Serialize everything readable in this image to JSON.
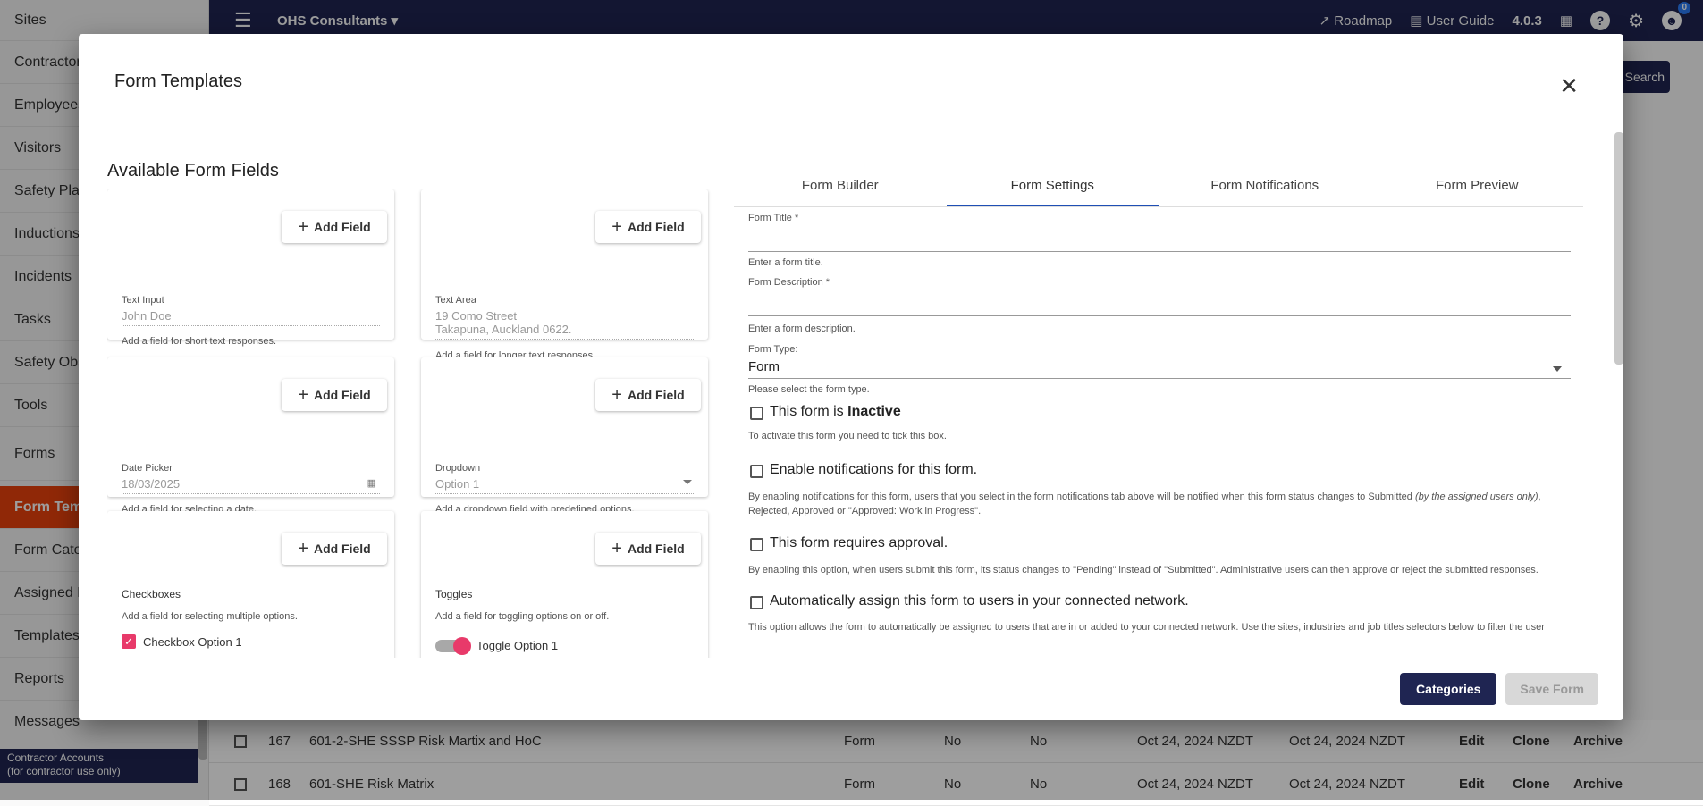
{
  "sidebar": {
    "items": [
      {
        "label": "Sites"
      },
      {
        "label": "Contractors"
      },
      {
        "label": "Employees"
      },
      {
        "label": "Visitors"
      },
      {
        "label": "Safety Plans"
      },
      {
        "label": "Inductions"
      },
      {
        "label": "Incidents"
      },
      {
        "label": "Tasks"
      },
      {
        "label": "Safety Observations"
      },
      {
        "label": "Tools"
      },
      {
        "label": "Forms"
      },
      {
        "label": "Form Templates"
      },
      {
        "label": "Form Categories"
      },
      {
        "label": "Assigned Forms"
      },
      {
        "label": "Templates"
      },
      {
        "label": "Reports"
      },
      {
        "label": "Messages"
      }
    ],
    "footer_line1": "Contractor Accounts",
    "footer_line2": "(for contractor use only)"
  },
  "topbar": {
    "org": "OHS Consultants",
    "roadmap": "Roadmap",
    "user_guide": "User Guide",
    "version": "4.0.3",
    "notifications_count": "0"
  },
  "background": {
    "search_label": "Search",
    "rows": [
      {
        "id": "167",
        "name": "601-2-SHE SSSP Risk Martix and HoC",
        "type": "Form",
        "a": "No",
        "b": "No",
        "created": "Oct 24, 2024 NZDT",
        "updated": "Oct 24, 2024 NZDT",
        "edit": "Edit",
        "clone": "Clone",
        "archive": "Archive"
      },
      {
        "id": "168",
        "name": "601-SHE Risk Matrix",
        "type": "Form",
        "a": "No",
        "b": "No",
        "created": "Oct 24, 2024 NZDT",
        "updated": "Oct 24, 2024 NZDT",
        "edit": "Edit",
        "clone": "Clone",
        "archive": "Archive"
      }
    ]
  },
  "modal": {
    "title": "Form Templates",
    "available_fields_title": "Available Form Fields",
    "add_field_label": "Add Field",
    "fields": {
      "text_input": {
        "label": "Text Input",
        "placeholder": "John Doe",
        "help": "Add a field for short text responses."
      },
      "text_area": {
        "label": "Text Area",
        "line1": "19 Como Street",
        "line2": "Takapuna, Auckland 0622.",
        "help": "Add a field for longer text responses."
      },
      "date_picker": {
        "label": "Date Picker",
        "value": "18/03/2025",
        "help": "Add a field for selecting a date."
      },
      "dropdown": {
        "label": "Dropdown",
        "value": "Option 1",
        "help": "Add a dropdown field with predefined options."
      },
      "checkboxes": {
        "label": "Checkboxes",
        "help": "Add a field for selecting multiple options.",
        "option1": "Checkbox Option 1"
      },
      "toggles": {
        "label": "Toggles",
        "help": "Add a field for toggling options on or off.",
        "option1": "Toggle Option 1"
      }
    },
    "tabs": [
      {
        "label": "Form Builder"
      },
      {
        "label": "Form Settings"
      },
      {
        "label": "Form Notifications"
      },
      {
        "label": "Form Preview"
      }
    ],
    "settings": {
      "form_title_label": "Form Title *",
      "form_title_help": "Enter a form title.",
      "form_desc_label": "Form Description *",
      "form_desc_help": "Enter a form description.",
      "form_type_label": "Form Type:",
      "form_type_value": "Form",
      "form_type_help": "Please select the form type.",
      "inactive_prefix": "This form is ",
      "inactive_bold": "Inactive",
      "inactive_help": "To activate this form you need to tick this box.",
      "notif_label": "Enable notifications for this form.",
      "notif_help_1": "By enabling notifications for this form, users that you select in the form notifications tab above will be notified when this form status changes to Submitted ",
      "notif_help_italic": "(by the assigned users only)",
      "notif_help_2": ",",
      "notif_help_3": "Rejected, Approved or \"Approved: Work in Progress\".",
      "approval_label": "This form requires approval.",
      "approval_help": "By enabling this option, when users submit this form, its status changes to \"Pending\" instead of \"Submitted\". Administrative users can then approve or reject the submitted responses.",
      "auto_label": "Automatically assign this form to users in your connected network.",
      "auto_help": "This option allows the form to automatically be assigned to users that are in or added to your connected network. Use the sites, industries and job titles selectors below to filter the user"
    },
    "buttons": {
      "categories": "Categories",
      "save": "Save Form"
    }
  }
}
